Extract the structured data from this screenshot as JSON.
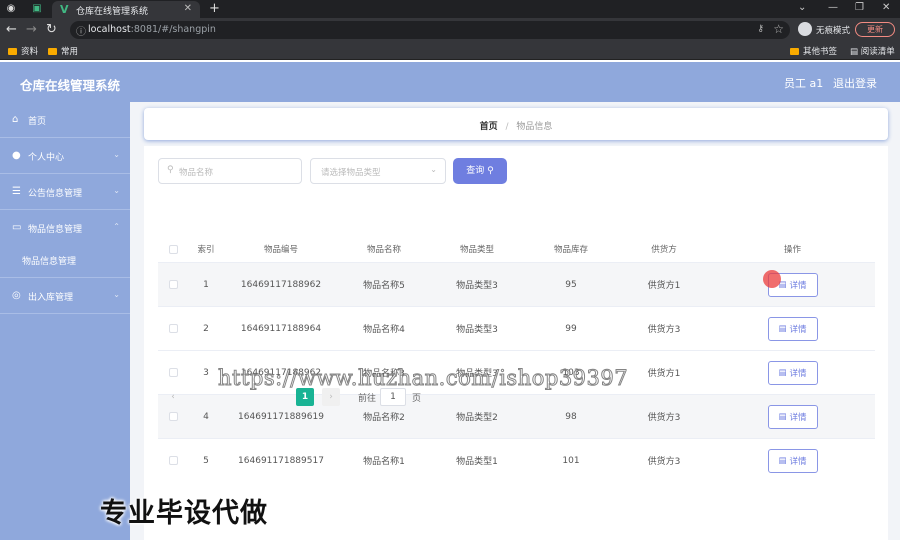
{
  "browser": {
    "tab_title": "仓库在线管理系统",
    "url_host": "localhost",
    "url_rest": ":8081/#/shangpin",
    "incognito_label": "无痕模式",
    "update_label": "更新",
    "bookmarks": [
      "资料",
      "常用"
    ],
    "bookmarks_right": [
      "其他书签",
      "阅读清单"
    ]
  },
  "app": {
    "title": "仓库在线管理系统",
    "user_label": "员工 a1",
    "logout_label": "退出登录"
  },
  "sidebar": {
    "items": [
      {
        "label": "首页",
        "icon": "home-icon"
      },
      {
        "label": "个人中心",
        "icon": "user-icon"
      },
      {
        "label": "公告信息管理",
        "icon": "notice-icon"
      },
      {
        "label": "物品信息管理",
        "icon": "goods-icon"
      },
      {
        "label": "出入库管理",
        "icon": "warehouse-icon"
      }
    ],
    "submenu": {
      "label": "物品信息管理"
    }
  },
  "breadcrumb": {
    "home": "首页",
    "separator": "/",
    "current": "物品信息"
  },
  "search": {
    "name_placeholder": "物品名称",
    "type_placeholder": "请选择物品类型",
    "query_label": "查询"
  },
  "table": {
    "headers": [
      "索引",
      "物品编号",
      "物品名称",
      "物品类型",
      "物品库存",
      "供货方",
      "操作"
    ],
    "rows": [
      {
        "index": "1",
        "code": "16469117188962",
        "name": "物品名称5",
        "type": "物品类型3",
        "stock": "95",
        "supplier": "供货方1",
        "action": "详情"
      },
      {
        "index": "2",
        "code": "16469117188964",
        "name": "物品名称4",
        "type": "物品类型3",
        "stock": "99",
        "supplier": "供货方3",
        "action": "详情"
      },
      {
        "index": "3",
        "code": "16469117188962",
        "name": "物品名称3",
        "type": "物品类型3",
        "stock": "103",
        "supplier": "供货方1",
        "action": "详情"
      },
      {
        "index": "4",
        "code": "164691171889619",
        "name": "物品名称2",
        "type": "物品类型2",
        "stock": "98",
        "supplier": "供货方3",
        "action": "详情"
      },
      {
        "index": "5",
        "code": "164691171889517",
        "name": "物品名称1",
        "type": "物品类型1",
        "stock": "101",
        "supplier": "供货方3",
        "action": "详情"
      }
    ]
  },
  "pagination": {
    "current_page": "1",
    "goto_label": "前往",
    "goto_value": "1",
    "page_suffix": "页"
  },
  "watermark": {
    "url": "https://www.huzhan.com/ishop39397",
    "caption": "专业毕设代做"
  }
}
